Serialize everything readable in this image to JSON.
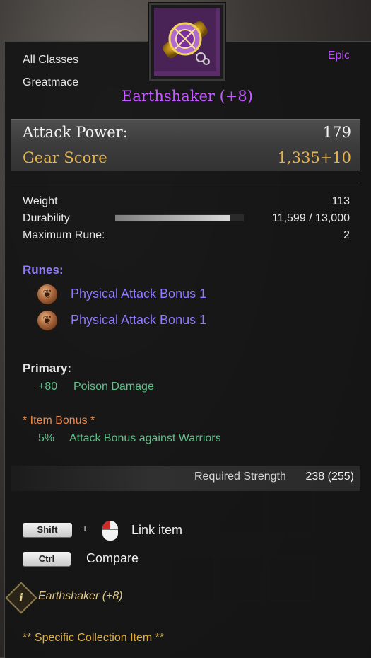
{
  "item": {
    "class_restriction": "All Classes",
    "weapon_type": "Greatmace",
    "rarity": "Epic",
    "name": "Earthshaker (+8)",
    "icon": "greatmace-icon"
  },
  "stats": {
    "attack_power_label": "Attack Power:",
    "attack_power_value": "179",
    "gear_score_label": "Gear Score",
    "gear_score_value": "1,335+10"
  },
  "details": {
    "weight_label": "Weight",
    "weight_value": "113",
    "durability_label": "Durability",
    "durability_value": "11,599 / 13,000",
    "durability_fraction": 0.89,
    "max_rune_label": "Maximum Rune:",
    "max_rune_value": "2"
  },
  "runes": {
    "heading": "Runes:",
    "items": [
      {
        "label": "Physical Attack Bonus 1",
        "icon": "rune-icon"
      },
      {
        "label": "Physical Attack Bonus 1",
        "icon": "rune-icon"
      }
    ]
  },
  "primary": {
    "heading": "Primary:",
    "value": "+80",
    "label": "Poison Damage"
  },
  "item_bonus": {
    "heading": "*  Item Bonus *",
    "value": "5%",
    "label": "Attack Bonus against Warriors"
  },
  "requirement": {
    "label": "Required Strength",
    "value": "238 (255)"
  },
  "help": {
    "link_key": "Shift",
    "plus": "+",
    "link_label": "Link item",
    "compare_key": "Ctrl",
    "compare_label": "Compare"
  },
  "collection": {
    "item_name": "Earthshaker (+8)",
    "specific_label": "** Specific Collection Item **"
  },
  "colors": {
    "epic": "#c45bff",
    "gear_score": "#e7b44a",
    "rune": "#8e7bff",
    "bonus_green": "#5fc08a",
    "item_bonus_heading": "#e88c4f"
  }
}
